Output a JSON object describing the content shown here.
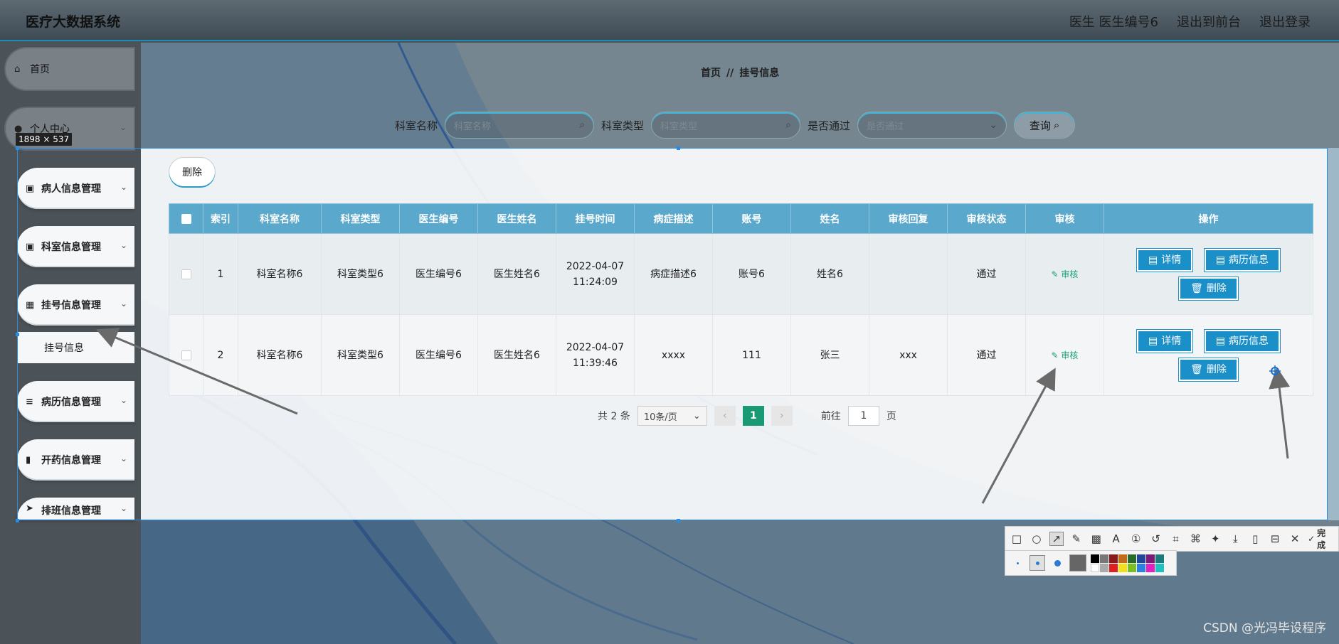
{
  "app": {
    "title": "医疗大数据系统",
    "user_label": "医生 医生编号6",
    "back_front": "退出到前台",
    "logout": "退出登录"
  },
  "sidebar": {
    "items": [
      {
        "label": "首页",
        "icon": "home-icon"
      },
      {
        "label": "个人中心",
        "icon": "user-icon"
      },
      {
        "label": "病人信息管理",
        "icon": "clipboard-icon"
      },
      {
        "label": "科室信息管理",
        "icon": "clipboard-icon"
      },
      {
        "label": "挂号信息管理",
        "icon": "grid-icon"
      },
      {
        "label": "病历信息管理",
        "icon": "list-icon"
      },
      {
        "label": "开药信息管理",
        "icon": "chart-icon"
      },
      {
        "label": "排班信息管理",
        "icon": "send-icon"
      }
    ],
    "sub_item": "挂号信息"
  },
  "breadcrumb": {
    "home": "首页",
    "sep": "//",
    "current": "挂号信息"
  },
  "search": {
    "dept_label": "科室名称",
    "dept_placeholder": "科室名称",
    "type_label": "科室类型",
    "type_placeholder": "科室类型",
    "pass_label": "是否通过",
    "pass_placeholder": "是否通过",
    "query_btn": "查询"
  },
  "toolbar": {
    "delete_label": "删除"
  },
  "selection_label": "1898 × 537",
  "table": {
    "headers": [
      "索引",
      "科室名称",
      "科室类型",
      "医生编号",
      "医生姓名",
      "挂号时间",
      "病症描述",
      "账号",
      "姓名",
      "审核回复",
      "审核状态",
      "审核",
      "操作"
    ],
    "rows": [
      {
        "index": "1",
        "dept": "科室名称6",
        "type": "科室类型6",
        "doc_no": "医生编号6",
        "doc_name": "医生姓名6",
        "time": "2022-04-07 11:24:09",
        "desc": "病症描述6",
        "account": "账号6",
        "name": "姓名6",
        "reply": "",
        "status": "通过",
        "audit": "审核"
      },
      {
        "index": "2",
        "dept": "科室名称6",
        "type": "科室类型6",
        "doc_no": "医生编号6",
        "doc_name": "医生姓名6",
        "time": "2022-04-07 11:39:46",
        "desc": "xxxx",
        "account": "111",
        "name": "张三",
        "reply": "xxx",
        "status": "通过",
        "audit": "审核"
      }
    ],
    "ops": {
      "detail": "详情",
      "record": "病历信息",
      "delete": "删除"
    }
  },
  "pagination": {
    "total": "共 2 条",
    "page_size": "10条/页",
    "current": "1",
    "goto_label": "前往",
    "goto_value": "1",
    "page_unit": "页"
  },
  "snip": {
    "done_label": "完成"
  },
  "watermark": "CSDN @光冯毕设程序",
  "colors": {
    "accent": "#1b8fc7",
    "header_bg": "#5aa8cc",
    "pager_active": "#1a9a74",
    "selection_border": "#2b8be0"
  }
}
